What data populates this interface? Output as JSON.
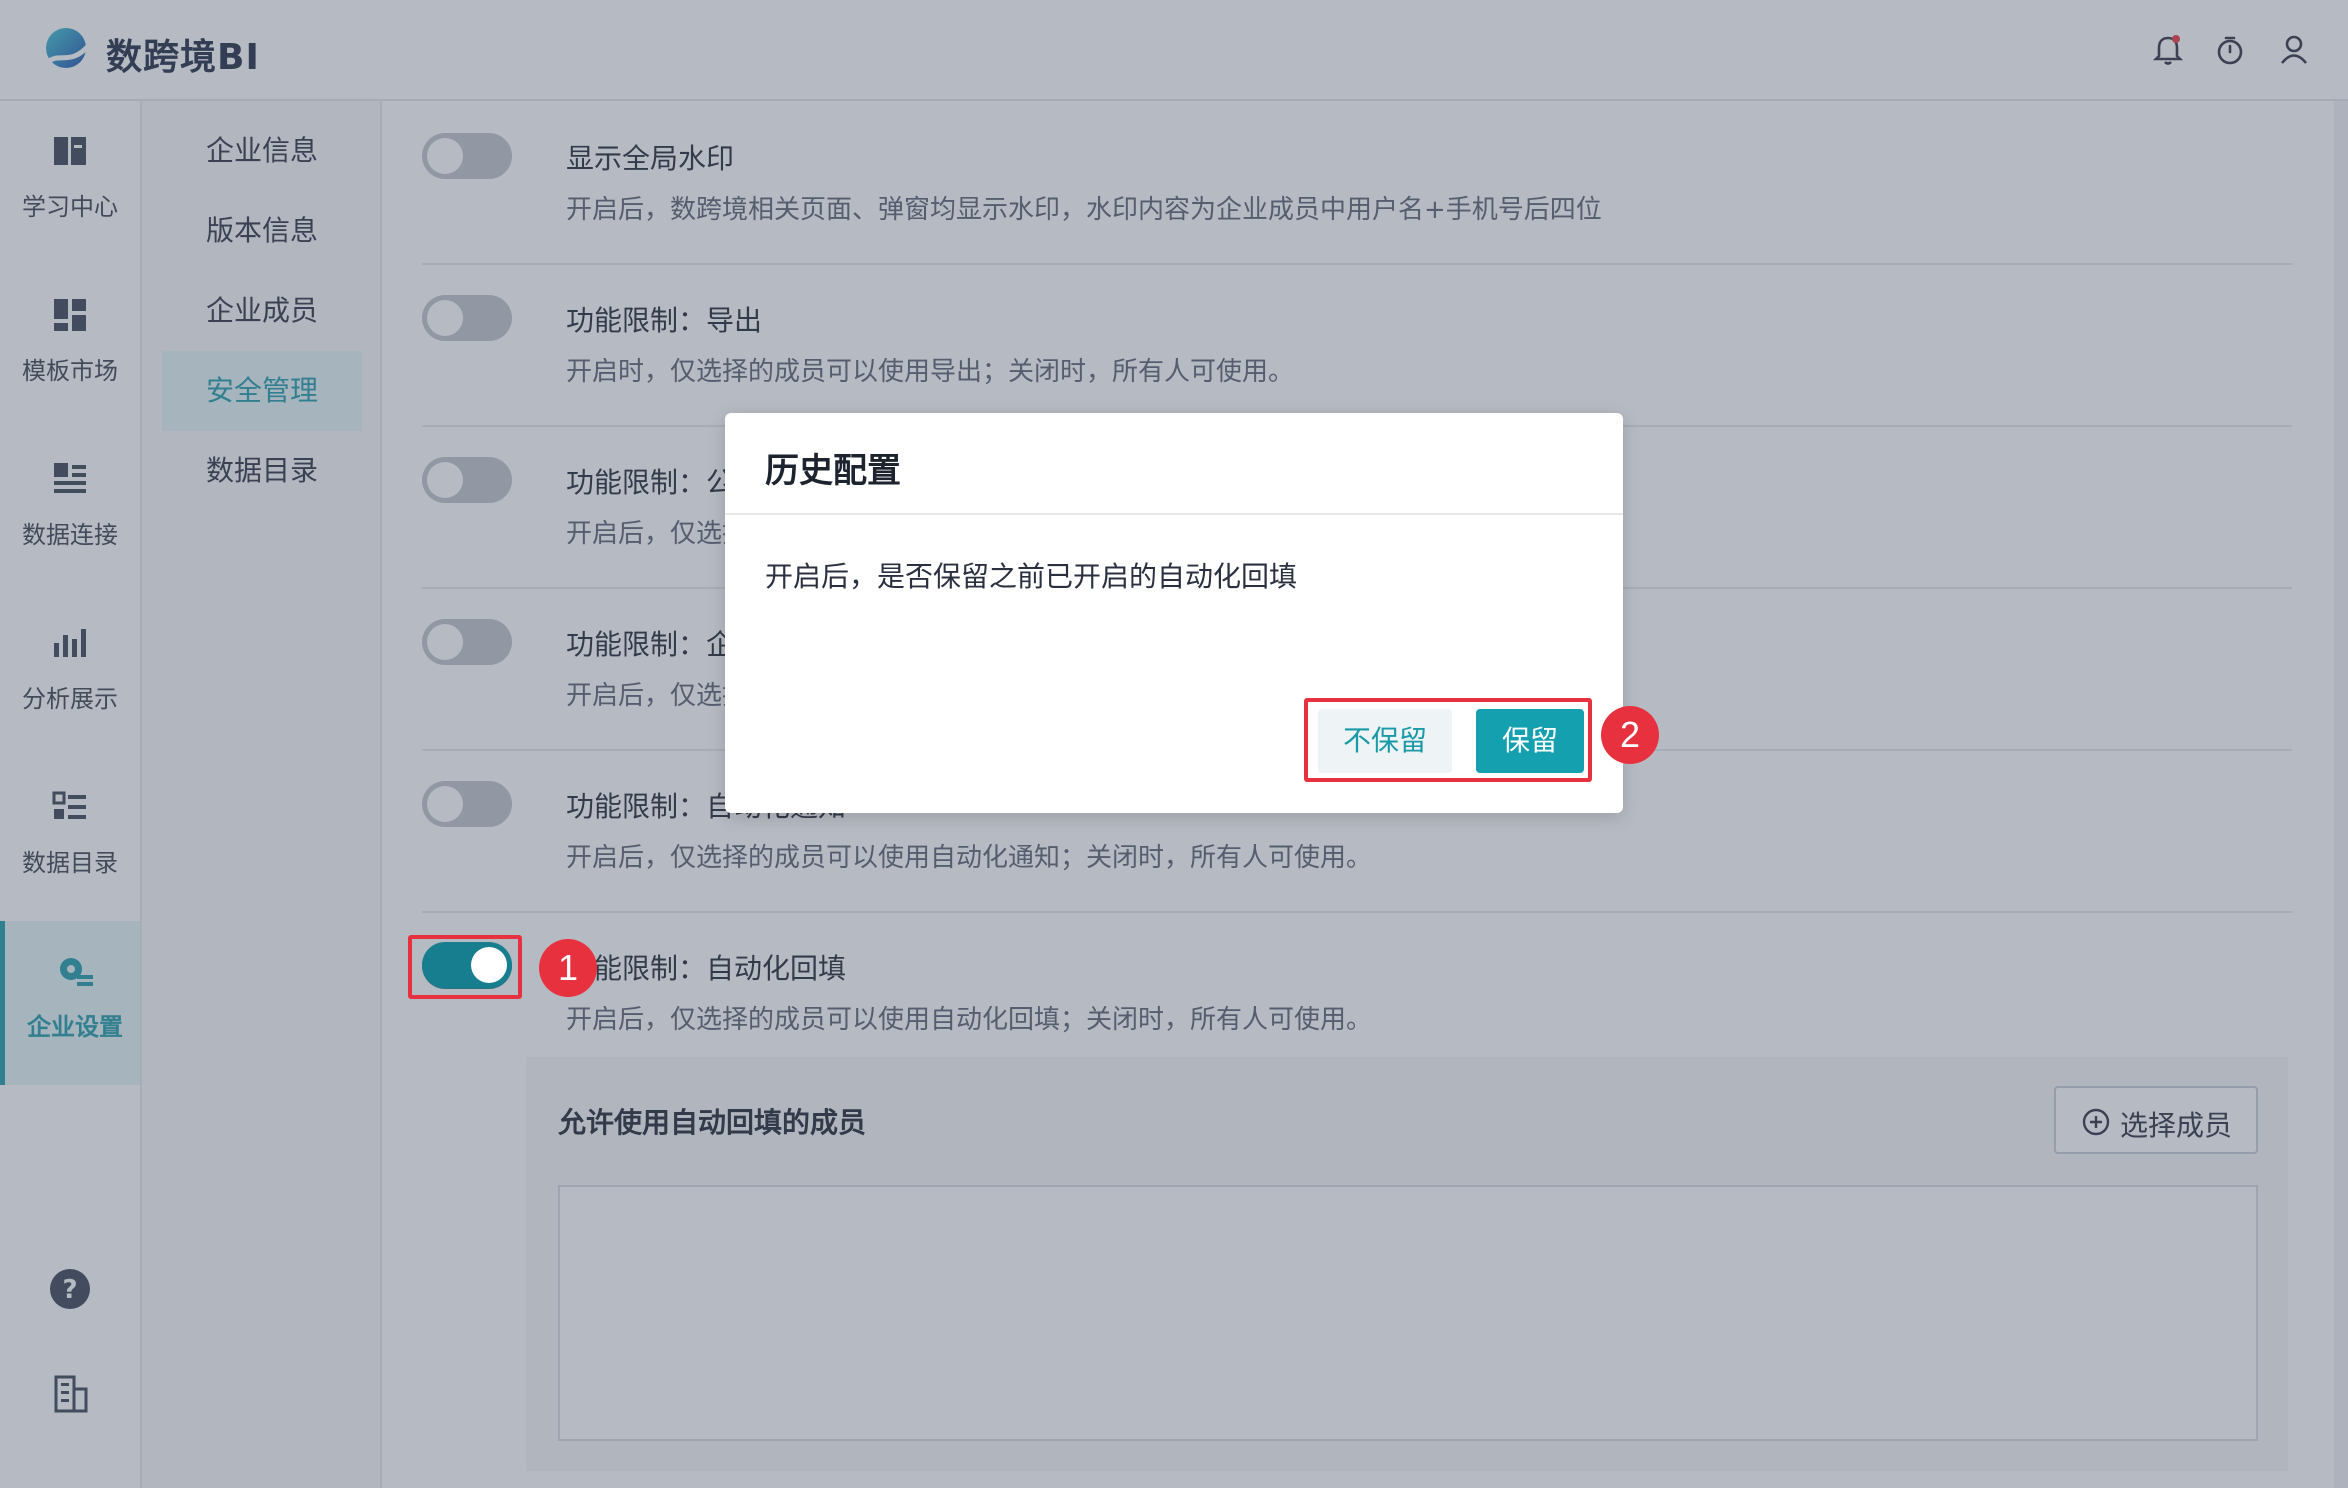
{
  "app": {
    "brand": "数跨境BI"
  },
  "header": {
    "icons": [
      "bell-icon",
      "timer-icon",
      "user-icon"
    ]
  },
  "rail": {
    "items": [
      {
        "label": "学习中心",
        "icon": "book-icon"
      },
      {
        "label": "模板市场",
        "icon": "template-icon"
      },
      {
        "label": "数据连接",
        "icon": "data-connect-icon"
      },
      {
        "label": "分析展示",
        "icon": "chart-icon"
      },
      {
        "label": "数据目录",
        "icon": "catalog-icon"
      },
      {
        "label": "企业设置",
        "icon": "settings-gear-icon",
        "active": true
      }
    ],
    "bottom_icons": [
      "help-icon",
      "building-icon"
    ]
  },
  "submenu": {
    "items": [
      {
        "label": "企业信息"
      },
      {
        "label": "版本信息"
      },
      {
        "label": "企业成员"
      },
      {
        "label": "安全管理",
        "active": true
      },
      {
        "label": "数据目录"
      }
    ]
  },
  "settings": [
    {
      "title": "显示全局水印",
      "desc": "开启后，数跨境相关页面、弹窗均显示水印，水印内容为企业成员中用户名+手机号后四位",
      "on": false
    },
    {
      "title": "功能限制：导出",
      "desc": "开启时，仅选择的成员可以使用导出；关闭时，所有人可使用。",
      "on": false
    },
    {
      "title": "功能限制：公开",
      "desc": "开启后，仅选择",
      "on": false
    },
    {
      "title": "功能限制：企业",
      "desc": "开启后，仅选择",
      "on": false
    },
    {
      "title": "功能限制：自动化通知",
      "desc": "开启后，仅选择的成员可以使用自动化通知；关闭时，所有人可使用。",
      "on": false
    },
    {
      "title": "功能限制：自动化回填",
      "desc": "开启后，仅选择的成员可以使用自动化回填；关闭时，所有人可使用。",
      "on": true
    }
  ],
  "members": {
    "title": "允许使用自动回填的成员",
    "select_button": "选择成员"
  },
  "dialog": {
    "title": "历史配置",
    "message": "开启后，是否保留之前已开启的自动化回填",
    "cancel_label": "不保留",
    "confirm_label": "保留"
  },
  "annotations": {
    "step1": "1",
    "step2": "2"
  },
  "colors": {
    "accent": "#1a9aa8",
    "toggle_on": "#167e8e",
    "annotation": "#e8313f"
  }
}
